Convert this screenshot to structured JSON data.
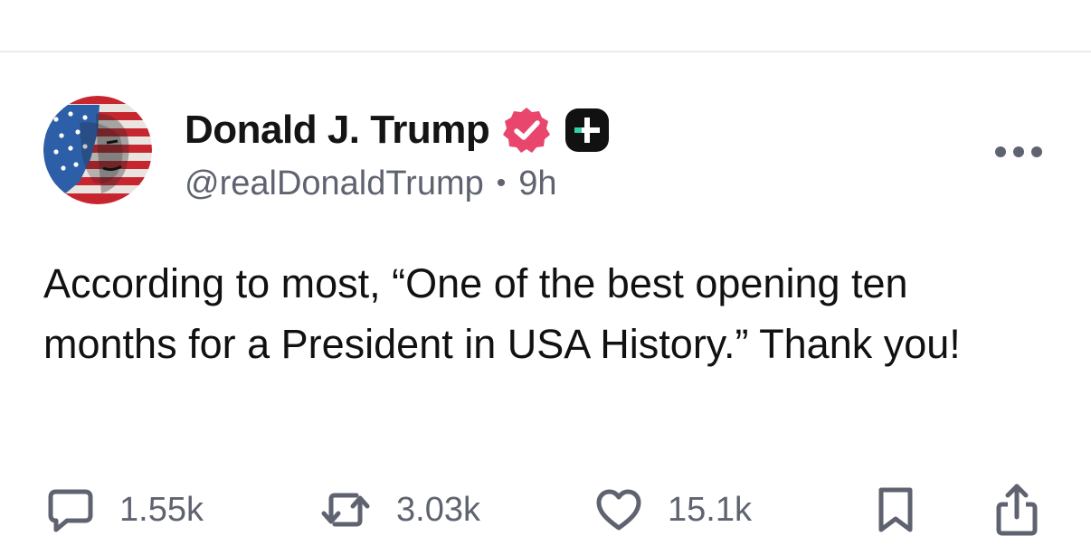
{
  "post": {
    "author": {
      "display_name": "Donald J. Trump",
      "handle": "@realDonaldTrump",
      "verified_badge_icon": "verified-check-icon",
      "subscription_badge_icon": "plus-badge-icon",
      "badge_color": "#e8466c"
    },
    "separator": "•",
    "time": "9h",
    "text": "According to most, “One of the best opening ten months for a President in USA History.” Thank you!"
  },
  "actions": {
    "reply": {
      "icon": "comment-icon",
      "count": "1.55k"
    },
    "repost": {
      "icon": "repost-icon",
      "count": "3.03k"
    },
    "like": {
      "icon": "heart-icon",
      "count": "15.1k"
    },
    "bookmark": {
      "icon": "bookmark-icon"
    },
    "share": {
      "icon": "share-icon"
    }
  },
  "more_menu_icon": "more-options-icon",
  "colors": {
    "text": "#111111",
    "muted": "#5f6370",
    "icon": "#5f6370",
    "divider": "#ececee"
  }
}
